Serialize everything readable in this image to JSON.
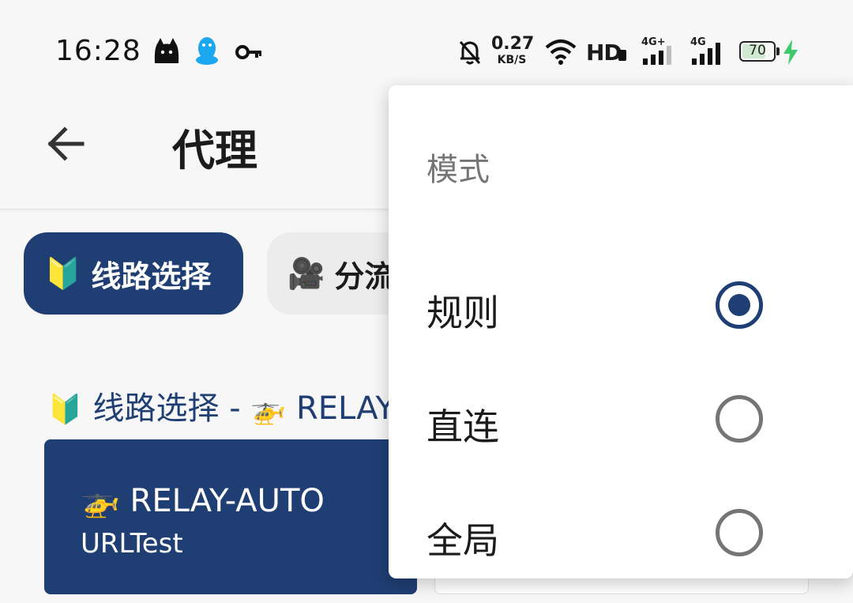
{
  "status_bar": {
    "time": "16:28",
    "notification_icons": [
      "cat-icon",
      "qq-penguin-icon",
      "key-icon"
    ],
    "net_speed_value": "0.27",
    "net_speed_unit": "KB/S",
    "hd_label": "HD",
    "sim1_label": "4G+",
    "sim2_label": "4G",
    "battery": "70",
    "charging": true
  },
  "app_bar": {
    "back_icon": "arrow-back-icon",
    "title": "代理"
  },
  "chips": [
    {
      "emoji": "🔰",
      "label": "线路选择",
      "selected": true
    },
    {
      "emoji": "🎥",
      "label": "分流",
      "selected": false
    }
  ],
  "section": {
    "emoji": "🔰",
    "text": "线路选择 - ",
    "emoji2": "🚁",
    "text2": "RELAY"
  },
  "cards": [
    {
      "emoji": "🚁",
      "name": "RELAY-AUTO",
      "type": "URLTest",
      "selected": true
    }
  ],
  "menu": {
    "title": "模式",
    "items": [
      {
        "label": "规则",
        "checked": true
      },
      {
        "label": "直连",
        "checked": false
      },
      {
        "label": "全局",
        "checked": false
      }
    ]
  },
  "colors": {
    "accent": "#1f3e73",
    "background": "#f7f7f7",
    "chip_unselected": "#ececec",
    "radio_unchecked": "#757575",
    "charging": "#3ec96b"
  }
}
